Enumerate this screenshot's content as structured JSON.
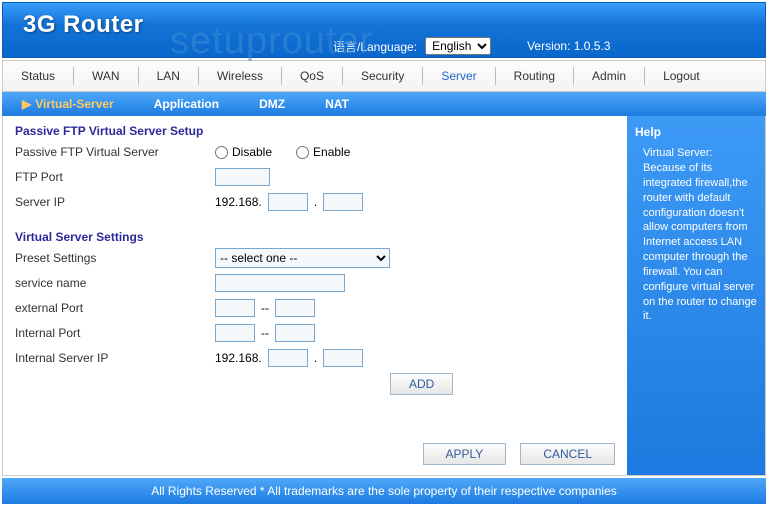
{
  "header": {
    "logo": "3G Router",
    "watermark": "setuprouter",
    "lang_label": "语言/Language:",
    "lang_selected": "English",
    "version_label": "Version: 1.0.5.3"
  },
  "nav": {
    "tabs": [
      "Status",
      "WAN",
      "LAN",
      "Wireless",
      "QoS",
      "Security",
      "Server",
      "Routing",
      "Admin",
      "Logout"
    ],
    "active_index": 6
  },
  "subnav": {
    "items": [
      "Virtual-Server",
      "Application",
      "DMZ",
      "NAT"
    ],
    "active_index": 0
  },
  "form": {
    "section1_title": "Passive FTP Virtual Server Setup",
    "passive_label": "Passive FTP Virtual Server",
    "disable": "Disable",
    "enable": "Enable",
    "ftp_port_label": "FTP Port",
    "server_ip_label": "Server IP",
    "ip_prefix": "192.168.",
    "section2_title": "Virtual Server Settings",
    "preset_label": "Preset Settings",
    "preset_selected": "-- select one --",
    "service_name_label": "service name",
    "external_port_label": "external Port",
    "internal_port_label": "Internal Port",
    "internal_ip_label": "Internal Server IP",
    "dash": "--",
    "add_btn": "ADD",
    "apply_btn": "APPLY",
    "cancel_btn": "CANCEL"
  },
  "help": {
    "title": "Help",
    "text": "Virtual Server: Because of its integrated firewall,the router with default configuration doesn't allow computers from Internet access LAN computer through the firewall. You can configure virtual server on the router to change it."
  },
  "footer": "All Rights Reserved * All trademarks are the sole property of their respective companies"
}
